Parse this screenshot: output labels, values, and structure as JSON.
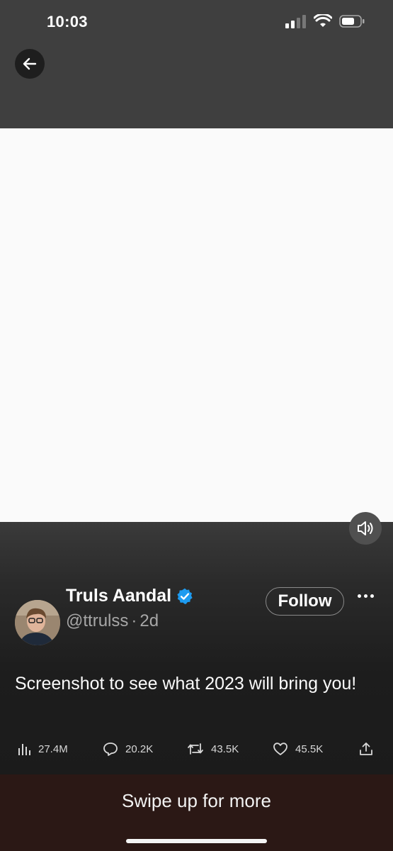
{
  "status_bar": {
    "time": "10:03"
  },
  "icons": {
    "back": "arrow-left-icon",
    "volume": "speaker-icon",
    "verified": "verified-badge-icon",
    "more": "more-dots-icon",
    "views": "views-chart-icon",
    "reply": "reply-bubble-icon",
    "retweet": "retweet-icon",
    "like": "heart-icon",
    "share": "share-icon"
  },
  "author": {
    "name": "Truls Aandal",
    "handle": "@ttrulss",
    "separator": "·",
    "time_ago": "2d"
  },
  "follow_label": "Follow",
  "tweet": {
    "text": "Screenshot to see what 2023 will bring you!"
  },
  "stats": {
    "views": "27.4M",
    "replies": "20.2K",
    "retweets": "43.5K",
    "likes": "45.5K"
  },
  "swipe_prompt": "Swipe up for more",
  "colors": {
    "verified": "#1d9bf0",
    "top_bar": "#3f3f3f",
    "swipe_bar": "#2b1815"
  }
}
